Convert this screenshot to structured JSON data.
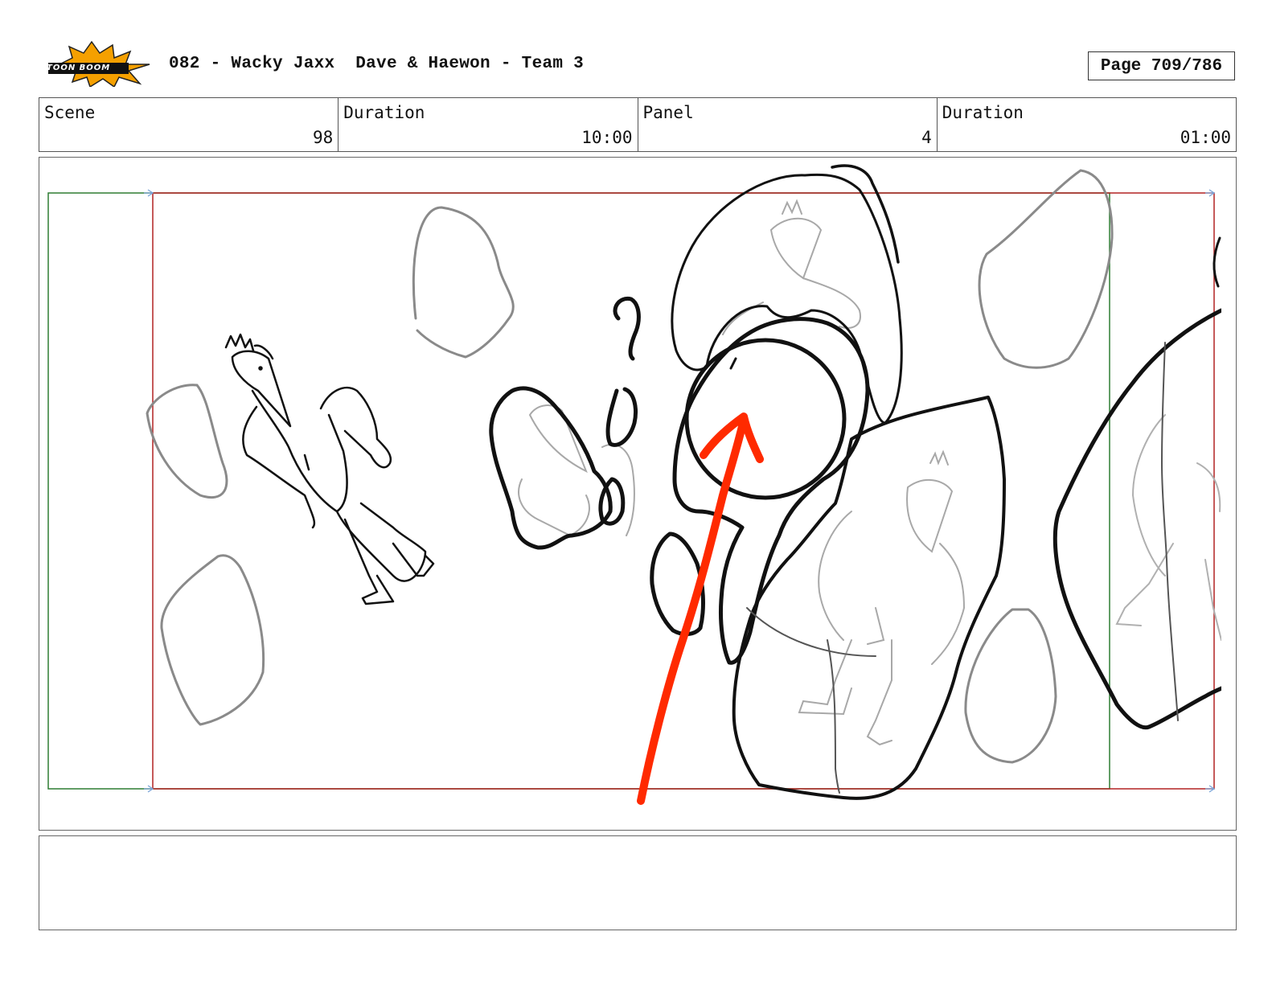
{
  "header": {
    "logo_text": "TOON BOOM",
    "title": "082 - Wacky Jaxx  Dave & Haewon - Team 3",
    "page": "Page 709/786"
  },
  "info": {
    "scene_label": "Scene",
    "scene_value": "98",
    "scene_duration_label": "Duration",
    "scene_duration_value": "10:00",
    "panel_label": "Panel",
    "panel_value": "4",
    "panel_duration_label": "Duration",
    "panel_duration_value": "01:00"
  },
  "notes": {
    "text": ""
  },
  "colors": {
    "safe_frame": "#2e7d32",
    "camera_frame": "#b22222",
    "arrow": "#ff2a00",
    "logo_burst": "#f5a000"
  }
}
